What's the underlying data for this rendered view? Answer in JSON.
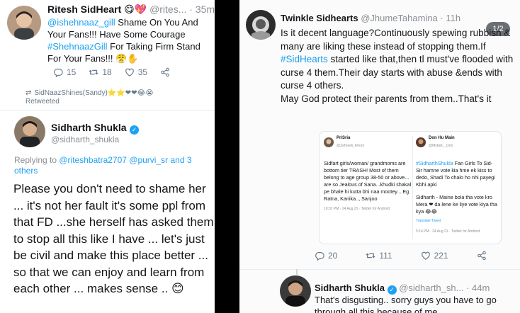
{
  "tweet1": {
    "name": "Ritesh SidHeart",
    "name_emojis": "😋💖",
    "handle": "@rites...",
    "time": "· 35m",
    "body_mention": "@ishehnaaz_gill",
    "body_text_1": " Shame On You And Your Fans!!! Have Some Courage ",
    "body_hashtag": "#ShehnaazGill",
    "body_text_2": " For Taking Firm Stand For Your Fans!!! ",
    "body_emojis": "😤✋",
    "replies": "15",
    "retweets": "18",
    "likes": "35"
  },
  "retweet_line": {
    "user": "SidNaazShines(Sandy)",
    "emojis": "⭐⭐❤❤😂😭",
    "label": "Retweeted"
  },
  "tweet2": {
    "name": "Sidharth Shukla",
    "verified": "✓",
    "handle": "@sidharth_shukla",
    "replying_prefix": "Replying to ",
    "replying_links": "@riteshbatra2707 @purvi_sr and 3 others",
    "body": "Please you don't need to shame her ... it's not her fault it's some ppl from that FD ...she herself has asked them to stop all this like I have ... let's just be civil and make this place better ... so that we can enjoy and learn from each other ... makes sense .. ",
    "body_emoji": "😊"
  },
  "tweet3": {
    "name": "Twinkle Sidhearts",
    "handle": "@JhumeTahamina",
    "time": "· 11h",
    "page_badge": "1/2",
    "body_1": "Is it decent language?Continuously spewing rubbish & many are liking these instead of stopping them.If ",
    "body_hashtag": "#SidHearts",
    "body_2": " started like that,then tl must've flooded with curse 4 them.Their day starts with abuse &ends with curse 4 others.",
    "body_3": "May God protect their parents from them..That's it",
    "quote_left": {
      "name": "PriSria",
      "handle": "@Zehreeli_Khoor",
      "text": "Sidfart girls/woman/ grandmoms are bottom tier TRASH! Most of them belong to age group 38-50 or above... are so Jealous of Sana...khudki shakal pe bhale hi kutta bhi naa mootey... Eg Ratna, Kanika.., Sanjoo",
      "meta": "10:01 PM · 24 Aug 21 · Twitter for Android"
    },
    "quote_right": {
      "name": "Don Hu Main",
      "handle": "@Mybell__Don",
      "hashtag": "#SidharthShukla",
      "text": " Fan Girls To Sid- Sir hamne vote kia hme ek kiss to dedo, Shadi To chalo ho nhi payegi Kbhi apki",
      "text2": "Sidharth - Maine bola tha vote kro Mera ❤ da lene ke liye vote kiya tha kya 😂😂",
      "translate": "Translate Tweet",
      "meta": "5:14 PM · 24 Aug 21 · Twitter for Android"
    },
    "replies": "20",
    "retweets": "111",
    "likes": "221"
  },
  "tweet4": {
    "name": "Sidharth Shukla",
    "verified": "✓",
    "handle": "@sidharth_sh...",
    "time": "· 44m",
    "body": "That's disgusting.. sorry guys you have to go through all this because of me ..."
  },
  "colors": {
    "link": "#1da1f2",
    "muted": "#8a8f94",
    "text": "#14171a",
    "like_red": "#e0245e"
  }
}
